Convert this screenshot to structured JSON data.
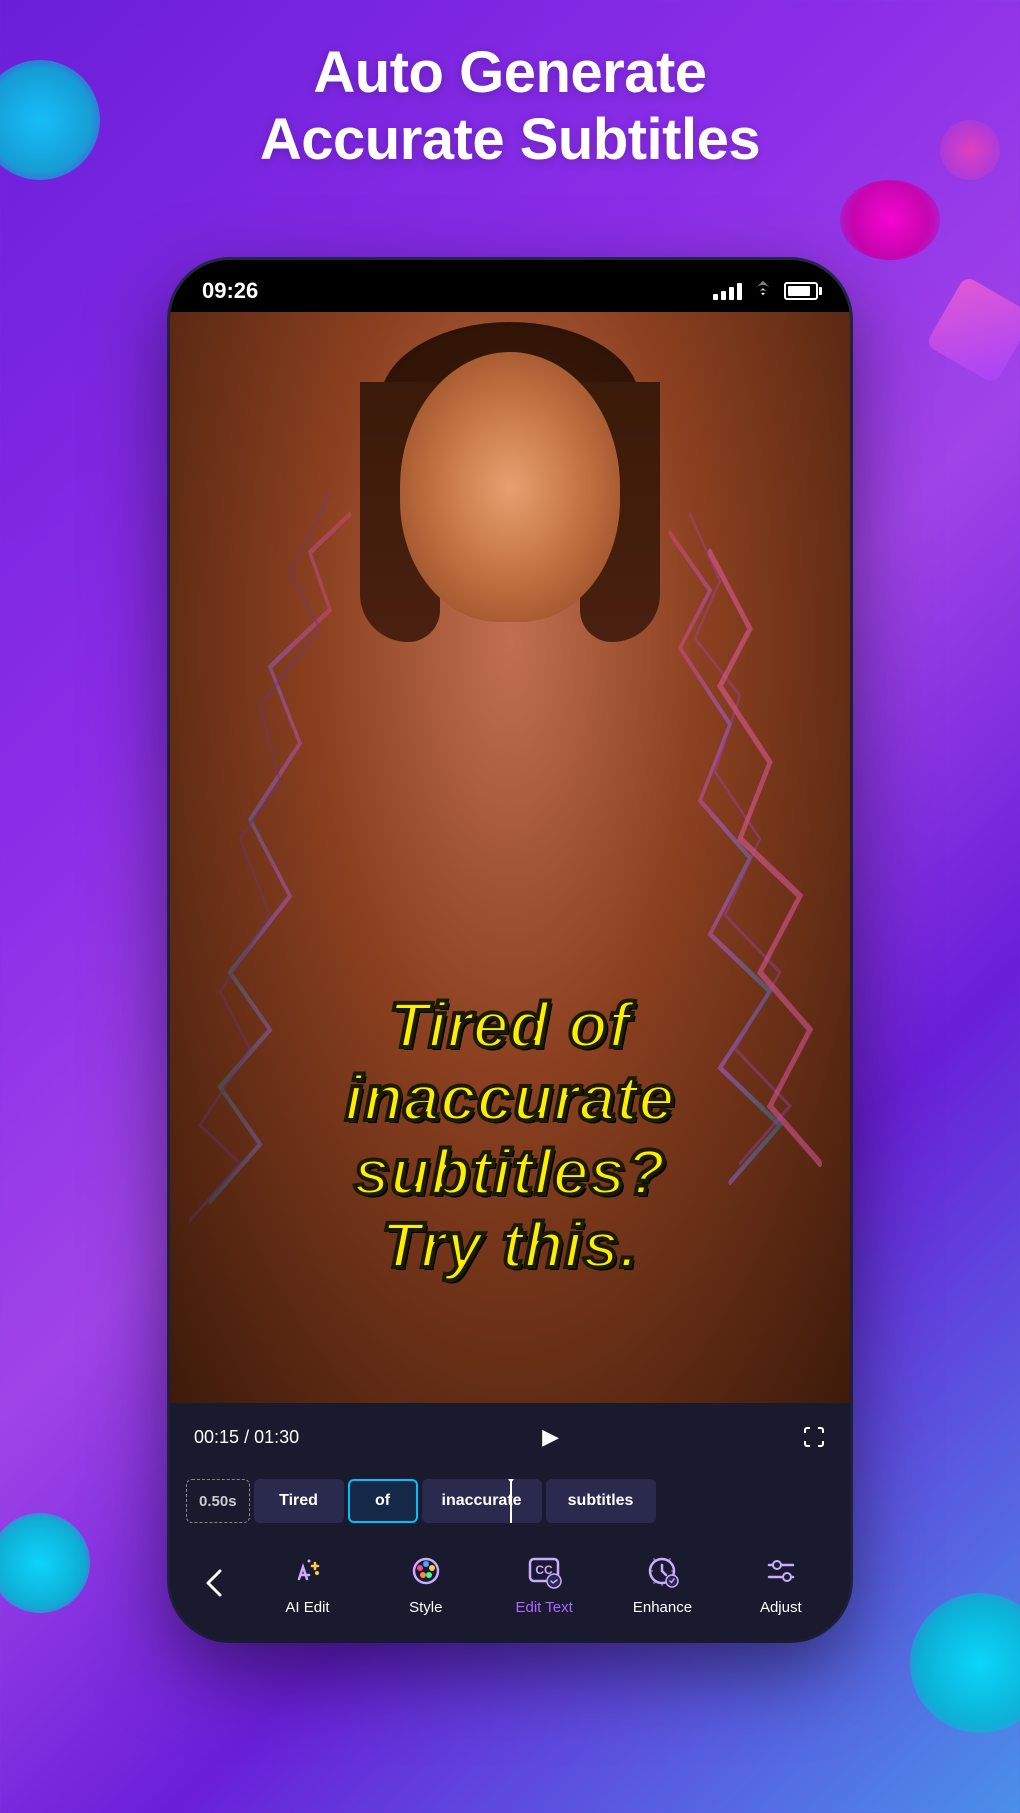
{
  "background": {
    "gradient_start": "#6a1fd8",
    "gradient_end": "#4a90e8"
  },
  "header": {
    "title_line1": "Auto Generate",
    "title_line2": "Accurate Subtitles"
  },
  "phone": {
    "status_bar": {
      "time": "09:26",
      "signal_alt": "signal bars",
      "wifi_alt": "wifi",
      "battery_alt": "battery"
    },
    "video": {
      "subtitle_text": "Tired of inaccurate subtitles? Try this."
    },
    "controls": {
      "time_current": "00:15",
      "time_separator": " / ",
      "time_total": "01:30",
      "play_label": "▶",
      "fullscreen_label": "⛶"
    },
    "timeline": {
      "duration_label": "0.50s",
      "items": [
        "Tired",
        "of",
        "inaccurate",
        "subtitles"
      ]
    },
    "toolbar": {
      "back_label": "‹",
      "items": [
        {
          "id": "ai-edit",
          "label": "AI Edit",
          "icon": "✨",
          "active": false
        },
        {
          "id": "style",
          "label": "Style",
          "icon": "🎨",
          "active": false
        },
        {
          "id": "edit-text",
          "label": "Edit Text",
          "icon": "⬛",
          "active": true
        },
        {
          "id": "enhance",
          "label": "Enhance",
          "icon": "▶",
          "active": false
        },
        {
          "id": "adjust",
          "label": "Adjust",
          "icon": "⚙",
          "active": false
        }
      ]
    }
  }
}
